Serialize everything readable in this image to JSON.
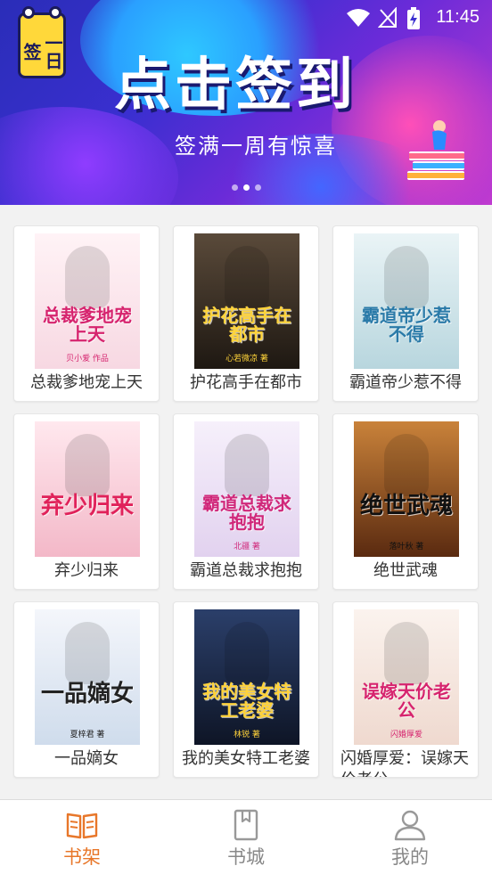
{
  "status_bar": {
    "time": "11:45"
  },
  "banner": {
    "logo_text": "一日签",
    "title": "点击签到",
    "subtitle": "签满一周有惊喜",
    "page_count": 3,
    "active_page": 2
  },
  "books": [
    {
      "label": "总裁爹地宠上天",
      "cover_title": "总裁爹地宠上天",
      "cover_author": "贝小爱 作品",
      "cover_bg": [
        "#fff3f6",
        "#f7d8e2"
      ],
      "cover_color": "#d6246e"
    },
    {
      "label": "护花高手在都市",
      "cover_title": "护花高手在都市",
      "cover_author": "心若微凉 著",
      "cover_bg": [
        "#5a4a3a",
        "#1e1812"
      ],
      "cover_color": "#ffd43a"
    },
    {
      "label": "霸道帝少惹不得",
      "cover_title": "霸道帝少惹不得",
      "cover_author": "",
      "cover_bg": [
        "#eaf4f6",
        "#b8d6de"
      ],
      "cover_color": "#2a7aa8"
    },
    {
      "label": "弃少归来",
      "cover_title": "弃少归来",
      "cover_author": "",
      "cover_bg": [
        "#ffe8ee",
        "#f3b8c8"
      ],
      "cover_color": "#e0225a"
    },
    {
      "label": "霸道总裁求抱抱",
      "cover_title": "霸道总裁求抱抱",
      "cover_author": "北疆 著",
      "cover_bg": [
        "#f6f0fb",
        "#e2d2ef"
      ],
      "cover_color": "#d0287a"
    },
    {
      "label": "绝世武魂",
      "cover_title": "绝世武魂",
      "cover_author": "落叶秋 著",
      "cover_bg": [
        "#c9823a",
        "#5a2a10"
      ],
      "cover_color": "#111111"
    },
    {
      "label": "一品嫡女",
      "cover_title": "一品嫡女",
      "cover_author": "夏梓君 著",
      "cover_bg": [
        "#f4f6fb",
        "#cfdcec"
      ],
      "cover_color": "#222222"
    },
    {
      "label": "我的美女特工老婆",
      "cover_title": "我的美女特工老婆",
      "cover_author": "林锐 著",
      "cover_bg": [
        "#2b3f6a",
        "#0e1526"
      ],
      "cover_color": "#ffd23a"
    },
    {
      "label": "闪婚厚爱：误嫁天价老公",
      "cover_title": "误嫁天价老公",
      "cover_author": "闪婚厚爱",
      "cover_bg": [
        "#fbf3ee",
        "#efd9cf"
      ],
      "cover_color": "#d6246e"
    }
  ],
  "bottom_nav": [
    {
      "label": "书架",
      "icon": "book-open-icon",
      "active": true
    },
    {
      "label": "书城",
      "icon": "bookmark-book-icon",
      "active": false
    },
    {
      "label": "我的",
      "icon": "user-icon",
      "active": false
    }
  ],
  "colors": {
    "accent": "#e8772a",
    "inactive": "#888888"
  }
}
